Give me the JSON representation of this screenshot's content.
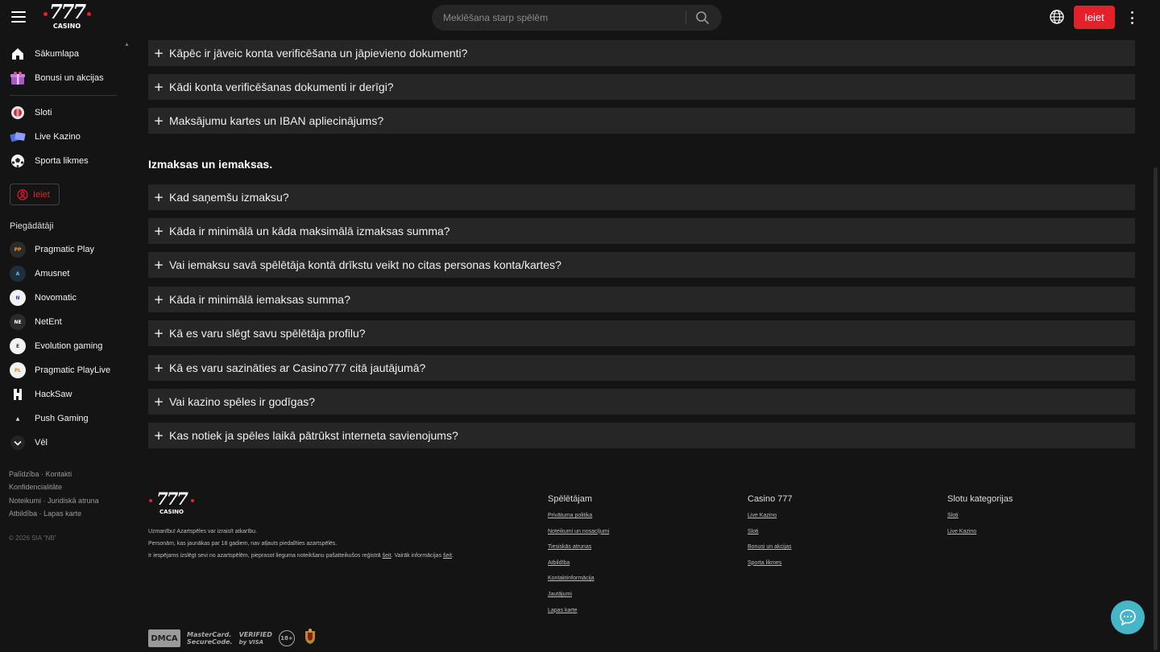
{
  "header": {
    "logo_number": "777",
    "logo_sub": "CASINO",
    "search_placeholder": "Meklēšana starp spēlēm",
    "login_label": "Ieiet"
  },
  "sidebar": {
    "main_items": [
      {
        "label": "Sākumlapa",
        "icon": "home-icon"
      },
      {
        "label": "Bonusi un akcijas",
        "icon": "gift-icon"
      }
    ],
    "game_items": [
      {
        "label": "Sloti",
        "icon": "slots-icon"
      },
      {
        "label": "Live Kazino",
        "icon": "live-casino-icon"
      },
      {
        "label": "Sporta likmes",
        "icon": "football-icon"
      }
    ],
    "login_label": "Ieiet",
    "providers_title": "Piegādātāji",
    "providers": [
      {
        "label": "Pragmatic Play",
        "icon": "pragmatic-play-icon"
      },
      {
        "label": "Amusnet",
        "icon": "amusnet-icon"
      },
      {
        "label": "Novomatic",
        "icon": "novomatic-icon"
      },
      {
        "label": "NetEnt",
        "icon": "netent-icon"
      },
      {
        "label": "Evolution gaming",
        "icon": "evolution-icon"
      },
      {
        "label": "Pragmatic PlayLive",
        "icon": "pragmatic-playlive-icon"
      },
      {
        "label": "HackSaw",
        "icon": "hacksaw-icon"
      },
      {
        "label": "Push Gaming",
        "icon": "push-gaming-icon"
      }
    ],
    "more_label": "Vēl",
    "links": {
      "help": "Palīdzība",
      "contacts": "Kontakti",
      "privacy": "Konfidencialitāte",
      "rules": "Noteikumi",
      "legal": "Juridiskā atruna",
      "responsibility": "Atbildība",
      "sitemap": "Lapas karte",
      "sep": "·"
    },
    "copyright": "© 2026 SIA \"NB\""
  },
  "faq_top": [
    "Kāpēc ir jāveic konta verificēšana un jāpievieno dokumenti?",
    "Kādi konta verificēšanas dokumenti ir derīgi?",
    "Maksājumu kartes un IBAN apliecinājums?"
  ],
  "section_title": "Izmaksas un iemaksas.",
  "faq_payments": [
    "Kad saņemšu izmaksu?",
    "Kāda ir minimālā un kāda maksimālā izmaksas summa?",
    "Vai iemaksu savā spēlētāja kontā drīkstu veikt no citas personas konta/kartes?",
    "Kāda ir minimālā iemaksas summa?",
    "Kā es varu slēgt savu spēlētāja profilu?",
    "Kā es varu sazināties ar Casino777 citā jautājumā?",
    "Vai kazino spēles ir godīgas?",
    "Kas notiek ja spēles laikā pātrūkst interneta savienojums?"
  ],
  "faq_plus": "+",
  "footer": {
    "warning": "Uzmanību! Azartspēles var izraisīt atkarību.",
    "minors": "Personām, kas jaunākas par 18 gadiem, nav atļauts piedalīties azartspēlēs.",
    "exclusion_text": "Ir iespējams izslēgt sevi no azartspēlēm, pieprasot liegumа noteikšanu pašatteikušos reģistrā",
    "exclusion_link": "šeit",
    "more_text": ". Vairāk informācijas",
    "more_link": "šeit",
    "end_dot": ".",
    "columns": [
      {
        "title": "Spēlētājam",
        "links": [
          "Privātuma politika",
          "Noteikumi un nosacījumi",
          "Tiesiskās atrunas",
          "Atbildība",
          "Kontaktinformācija",
          "Jautājumi",
          "Lapas karte"
        ]
      },
      {
        "title": "Casino 777",
        "links": [
          "Live Kazino",
          "Sloti",
          "Bonusi un akcijas",
          "Sporta likmes"
        ]
      },
      {
        "title": "Slotu kategorijas",
        "links": [
          "Sloti",
          "Live Kazino"
        ]
      }
    ],
    "badges": {
      "dmca": "DMCA",
      "mastercard_1": "MasterCard.",
      "mastercard_2": "SecureCode.",
      "visa_1": "VERIFIED",
      "visa_2": "by VISA",
      "age": "18+"
    }
  }
}
